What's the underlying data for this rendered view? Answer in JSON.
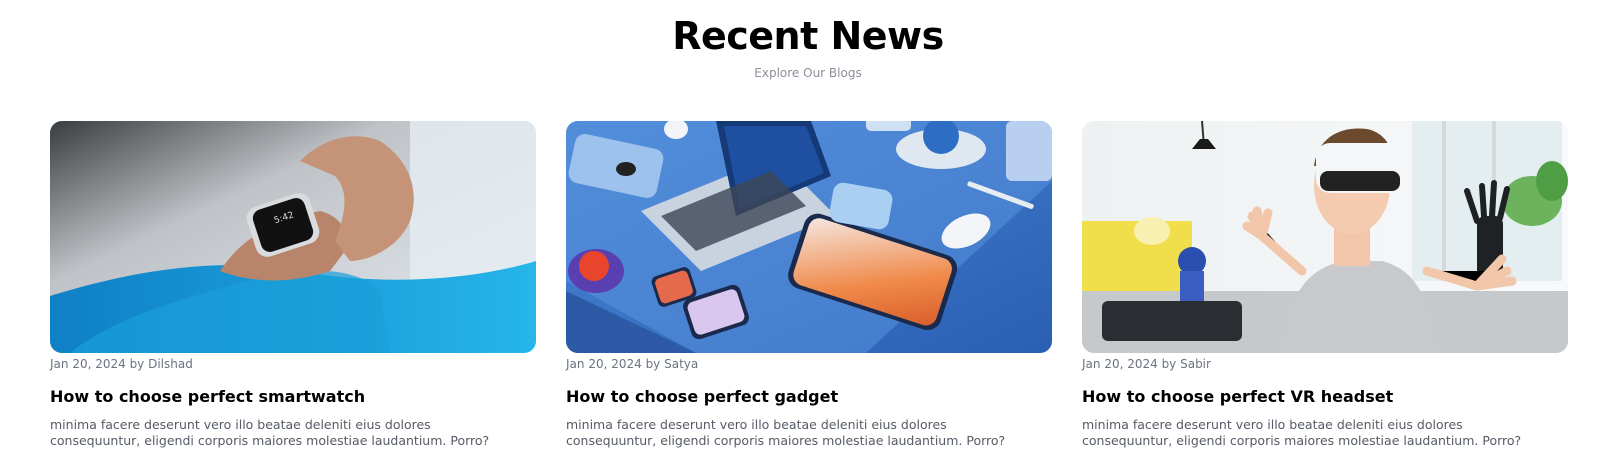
{
  "header": {
    "title": "Recent News",
    "subtitle": "Explore Our Blogs"
  },
  "posts": [
    {
      "image": "smartwatch-on-wrist-photo",
      "meta": "Jan 20, 2024 by Dilshad",
      "title": "How to choose perfect smartwatch",
      "excerpt": "minima facere deserunt vero illo beatae deleniti eius dolores consequuntur, eligendi corporis maiores molestiae laudantium. Porro?"
    },
    {
      "image": "gadgets-flat-lay-photo",
      "meta": "Jan 20, 2024 by Satya",
      "title": "How to choose perfect gadget",
      "excerpt": "minima facere deserunt vero illo beatae deleniti eius dolores consequuntur, eligendi corporis maiores molestiae laudantium. Porro?"
    },
    {
      "image": "boy-vr-headset-photo",
      "meta": "Jan 20, 2024 by Sabir",
      "title": "How to choose perfect VR headset",
      "excerpt": "minima facere deserunt vero illo beatae deleniti eius dolores consequuntur, eligendi corporis maiores molestiae laudantium. Porro?"
    }
  ],
  "colors": {
    "text_primary": "#000000",
    "text_muted": "#8a8f98",
    "meta": "#6b7280",
    "excerpt": "#555b66"
  }
}
